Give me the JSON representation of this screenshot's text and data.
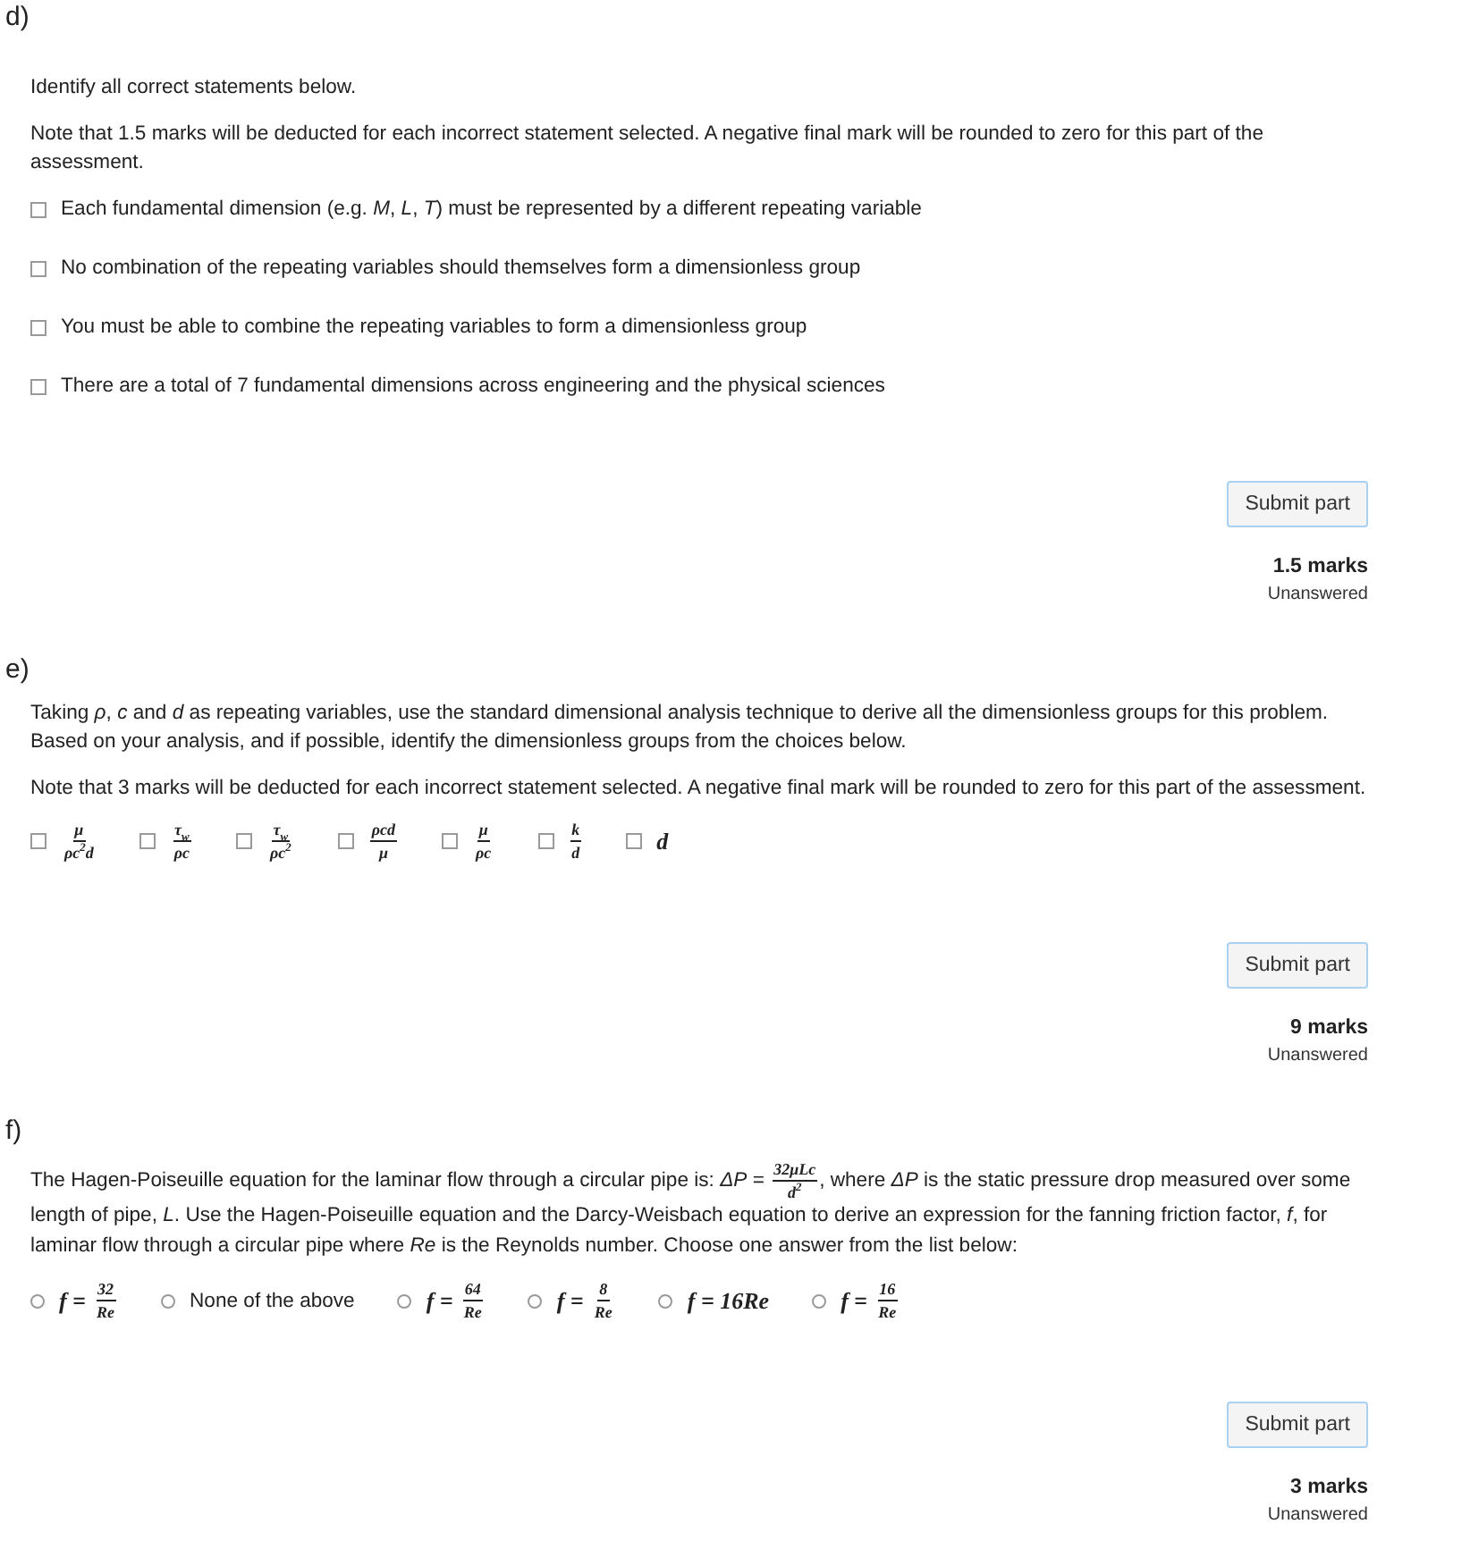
{
  "parts": [
    {
      "label": "d)",
      "kind": "checklist",
      "paragraphs": [
        {
          "text": "Identify all correct statements below."
        },
        {
          "text": "Note that 1.5 marks will be deducted for each incorrect statement selected. A negative final mark will be rounded to zero for this part of the assessment."
        }
      ],
      "options": [
        {
          "kind": "text",
          "text": "Each fundamental dimension (e.g. *M*, *L*, *T*) must be represented by a different repeating variable",
          "checked": false
        },
        {
          "kind": "text",
          "text": "No combination of the repeating variables should themselves form a dimensionless group",
          "checked": false
        },
        {
          "kind": "text",
          "text": "You must be able to combine the repeating variables to form a dimensionless group",
          "checked": false
        },
        {
          "kind": "text",
          "text": "There are a total of 7 fundamental dimensions across engineering and the physical sciences",
          "checked": false
        }
      ],
      "submit": {
        "label": "Submit part",
        "marks": "1.5 marks",
        "status": "Unanswered"
      }
    },
    {
      "label": "e)",
      "kind": "checkrow",
      "paragraphs": [
        {
          "text": "Taking *ρ*, *c* and *d* as repeating variables, use the standard dimensional analysis technique to derive all the dimensionless groups for this problem. Based on your analysis, and if possible, identify the dimensionless groups from the choices below."
        },
        {
          "text": "Note that 3 marks will be deducted for each incorrect statement selected. A negative final mark will be rounded to zero for this part of the assessment."
        }
      ],
      "options": [
        {
          "kind": "fraction",
          "numerator": "μ",
          "denominator": "ρc$^{2}$d",
          "checked": false
        },
        {
          "kind": "fraction",
          "numerator": "τ$_{w}$",
          "denominator": "ρc",
          "checked": false
        },
        {
          "kind": "fraction",
          "numerator": "τ$_{w}$",
          "denominator": "ρc$^{2}$",
          "checked": false
        },
        {
          "kind": "fraction",
          "numerator": "ρcd",
          "denominator": "μ",
          "checked": false
        },
        {
          "kind": "fraction",
          "numerator": "μ",
          "denominator": "ρc",
          "checked": false
        },
        {
          "kind": "fraction",
          "numerator": "k",
          "denominator": "d",
          "checked": false
        },
        {
          "kind": "math",
          "text": "d",
          "checked": false
        }
      ],
      "submit": {
        "label": "Submit part",
        "marks": "9 marks",
        "status": "Unanswered"
      }
    },
    {
      "label": "f)",
      "kind": "radiorow",
      "paragraphs": [
        {
          "text": "The Hagen-Poiseuille equation for the laminar flow through a circular pipe is: *ΔP* =",
          "fraction": {
            "numerator": "32μLc",
            "denominator": "d$^{2}$"
          },
          "after": ", where *ΔP* is the static pressure drop measured over some length of pipe, *L*. Use the Hagen-Poiseuille equation and the Darcy-Weisbach equation to derive an expression for the fanning friction factor, *f*, for laminar flow through a circular pipe where *Re* is the Reynolds number. Choose one answer from the list below:"
        }
      ],
      "options": [
        {
          "kind": "fraction",
          "lhs": "*f* =",
          "numerator": "32",
          "denominator": "Re",
          "selected": false
        },
        {
          "kind": "text",
          "text": "None of the above",
          "selected": false
        },
        {
          "kind": "fraction",
          "lhs": "*f* =",
          "numerator": "64",
          "denominator": "Re",
          "selected": false
        },
        {
          "kind": "fraction",
          "lhs": "*f* =",
          "numerator": "8",
          "denominator": "Re",
          "selected": false
        },
        {
          "kind": "math",
          "text": "f = 16Re",
          "selected": false
        },
        {
          "kind": "fraction",
          "lhs": "*f* =",
          "numerator": "16",
          "denominator": "Re",
          "selected": false
        }
      ],
      "submit": {
        "label": "Submit part",
        "marks": "3 marks",
        "status": "Unanswered"
      }
    }
  ]
}
